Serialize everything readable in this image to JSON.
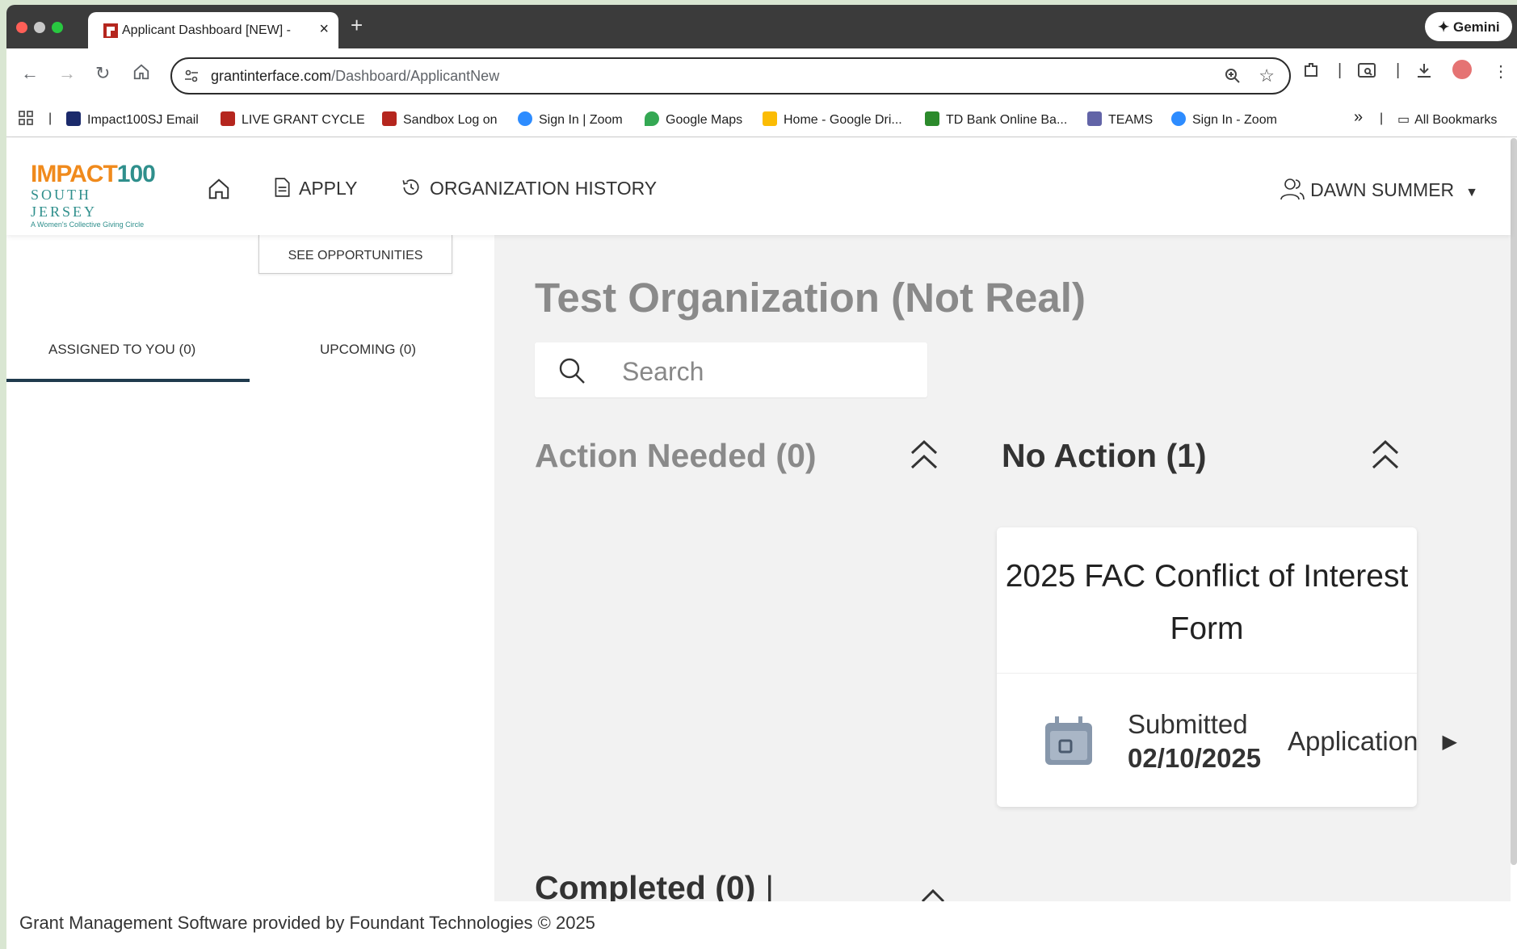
{
  "browser": {
    "tab_title": "Applicant Dashboard [NEW] -",
    "new_tab_label": "+",
    "close_label": "×",
    "gemini_label": "Gemini",
    "url_host": "grantinterface.com",
    "url_path": "/Dashboard/ApplicantNew",
    "bookmarks": [
      {
        "label": "Impact100SJ Email",
        "icon": "impact-n-icon",
        "color": "#1b2a6b"
      },
      {
        "label": "LIVE GRANT CYCLE",
        "icon": "foundant-icon",
        "color": "#b5261e"
      },
      {
        "label": "Sandbox Log on",
        "icon": "foundant-icon",
        "color": "#b5261e"
      },
      {
        "label": "Sign In | Zoom",
        "icon": "zoom-icon",
        "color": "#2d8cff"
      },
      {
        "label": "Google Maps",
        "icon": "maps-pin-icon",
        "color": "#34a853"
      },
      {
        "label": "Home - Google Dri...",
        "icon": "drive-icon",
        "color": "#fbbc04"
      },
      {
        "label": "TD Bank Online Ba...",
        "icon": "td-icon",
        "color": "#2c8a2c"
      },
      {
        "label": "TEAMS",
        "icon": "teams-icon",
        "color": "#6264a7"
      },
      {
        "label": "Sign In - Zoom",
        "icon": "zoom-icon",
        "color": "#2d8cff"
      }
    ],
    "all_bookmarks_label": "All Bookmarks",
    "overflow_label": "»"
  },
  "header": {
    "logo_top_a": "IMPACT",
    "logo_top_b": "100",
    "logo_mid": "SOUTH JERSEY",
    "logo_sub": "A Women's Collective Giving Circle",
    "nav": {
      "apply": "APPLY",
      "history": "ORGANIZATION HISTORY"
    },
    "user_name": "DAWN SUMMER"
  },
  "left": {
    "see_opportunities": "SEE OPPORTUNITIES",
    "tabs": [
      {
        "label": "ASSIGNED TO YOU (0)",
        "active": true
      },
      {
        "label": "UPCOMING (0)",
        "active": false
      }
    ]
  },
  "main": {
    "org_title": "Test Organization (Not Real)",
    "search_placeholder": "Search",
    "action_needed": "Action Needed (0)",
    "no_action": "No Action (1)",
    "completed": "Completed (0)",
    "card": {
      "title": "2025 FAC Conflict of Interest Form",
      "status": "Submitted",
      "date": "02/10/2025",
      "type": "Application"
    }
  },
  "footer": {
    "text": "Grant Management Software provided by Foundant Technologies © 2025"
  },
  "colors": {
    "active_tab_underline": "#1f3a4d",
    "logo_orange": "#f08a1c",
    "logo_teal": "#2f8f8c",
    "muted_title": "#8a8a8a"
  }
}
